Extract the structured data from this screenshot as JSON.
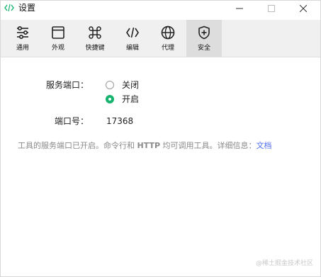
{
  "window": {
    "title": "设置",
    "app_icon": "code-icon",
    "accent_color": "#16b36e"
  },
  "toolbar": {
    "items": [
      {
        "label": "通用",
        "icon": "sliders-icon",
        "active": false
      },
      {
        "label": "外观",
        "icon": "window-icon",
        "active": false
      },
      {
        "label": "快捷键",
        "icon": "command-icon",
        "active": false
      },
      {
        "label": "编辑",
        "icon": "code-brackets-icon",
        "active": false
      },
      {
        "label": "代理",
        "icon": "globe-icon",
        "active": false
      },
      {
        "label": "安全",
        "icon": "shield-plus-icon",
        "active": true
      }
    ]
  },
  "security": {
    "service_port_label": "服务端口：",
    "options": [
      {
        "label": "关闭",
        "checked": false
      },
      {
        "label": "开启",
        "checked": true
      }
    ],
    "port_number_label": "端口号：",
    "port_number_value": "17368",
    "info_text_before": "工具的服务端口已开启。命令行和 ",
    "info_text_bold": "HTTP",
    "info_text_after": " 均可调用工具。详细信息：",
    "info_link_text": "文档"
  },
  "watermark": "@稀土掘金技术社区"
}
